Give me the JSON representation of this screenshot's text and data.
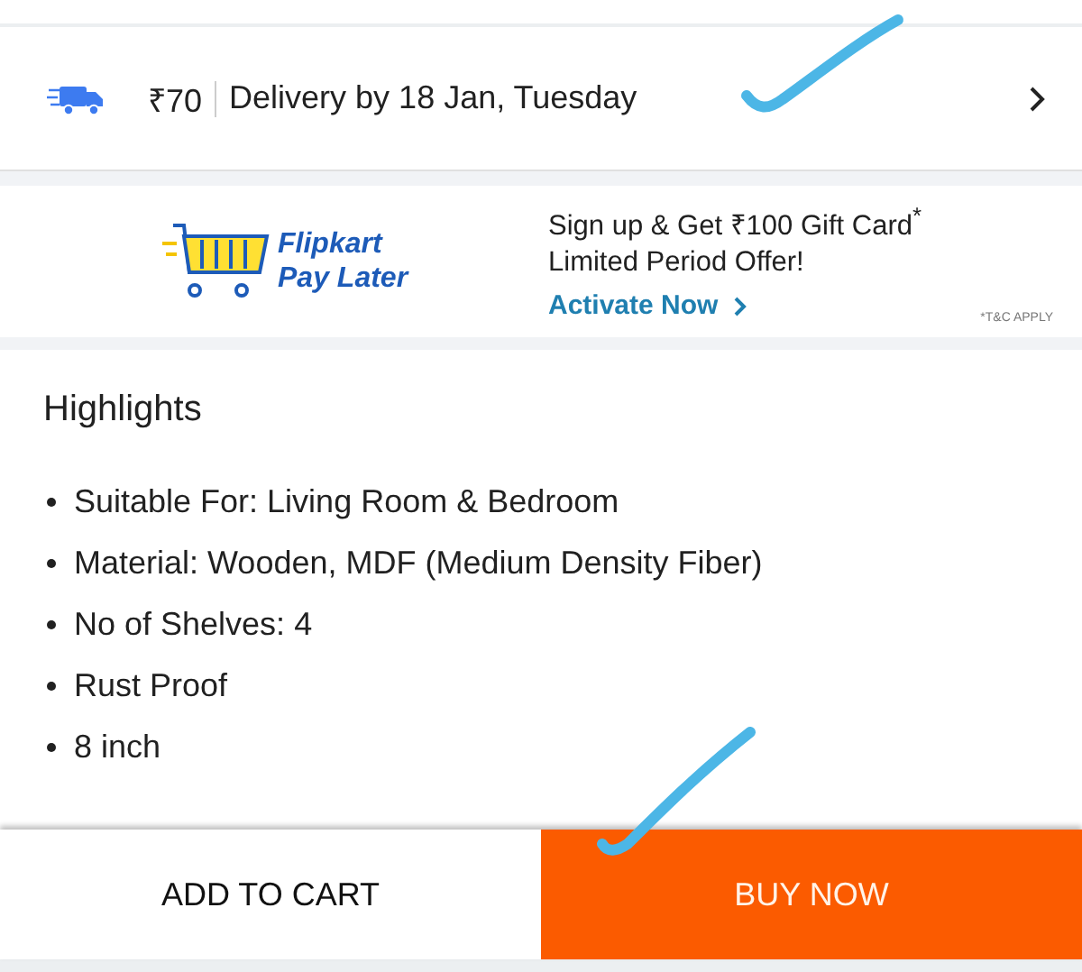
{
  "delivery": {
    "price": "₹70",
    "text": "Delivery by 18 Jan, Tuesday"
  },
  "promo": {
    "logo_lines": [
      "Flipkart",
      "Pay Later"
    ],
    "headline": "Sign up & Get ₹100 Gift Card$^{*}$",
    "subline": "Limited Period Offer!",
    "link": "Activate Now",
    "terms": "*T&C APPLY"
  },
  "highlights": {
    "title": "Highlights",
    "items": [
      "Suitable For: Living Room & Bedroom",
      "Material: Wooden, MDF (Medium Density Fiber)",
      "No of Shelves: 4",
      "Rust Proof",
      "8 inch"
    ]
  },
  "actions": [
    {
      "label": "ADD TO CART",
      "kind": "secondary"
    },
    {
      "label": "BUY NOW",
      "kind": "primary"
    }
  ]
}
